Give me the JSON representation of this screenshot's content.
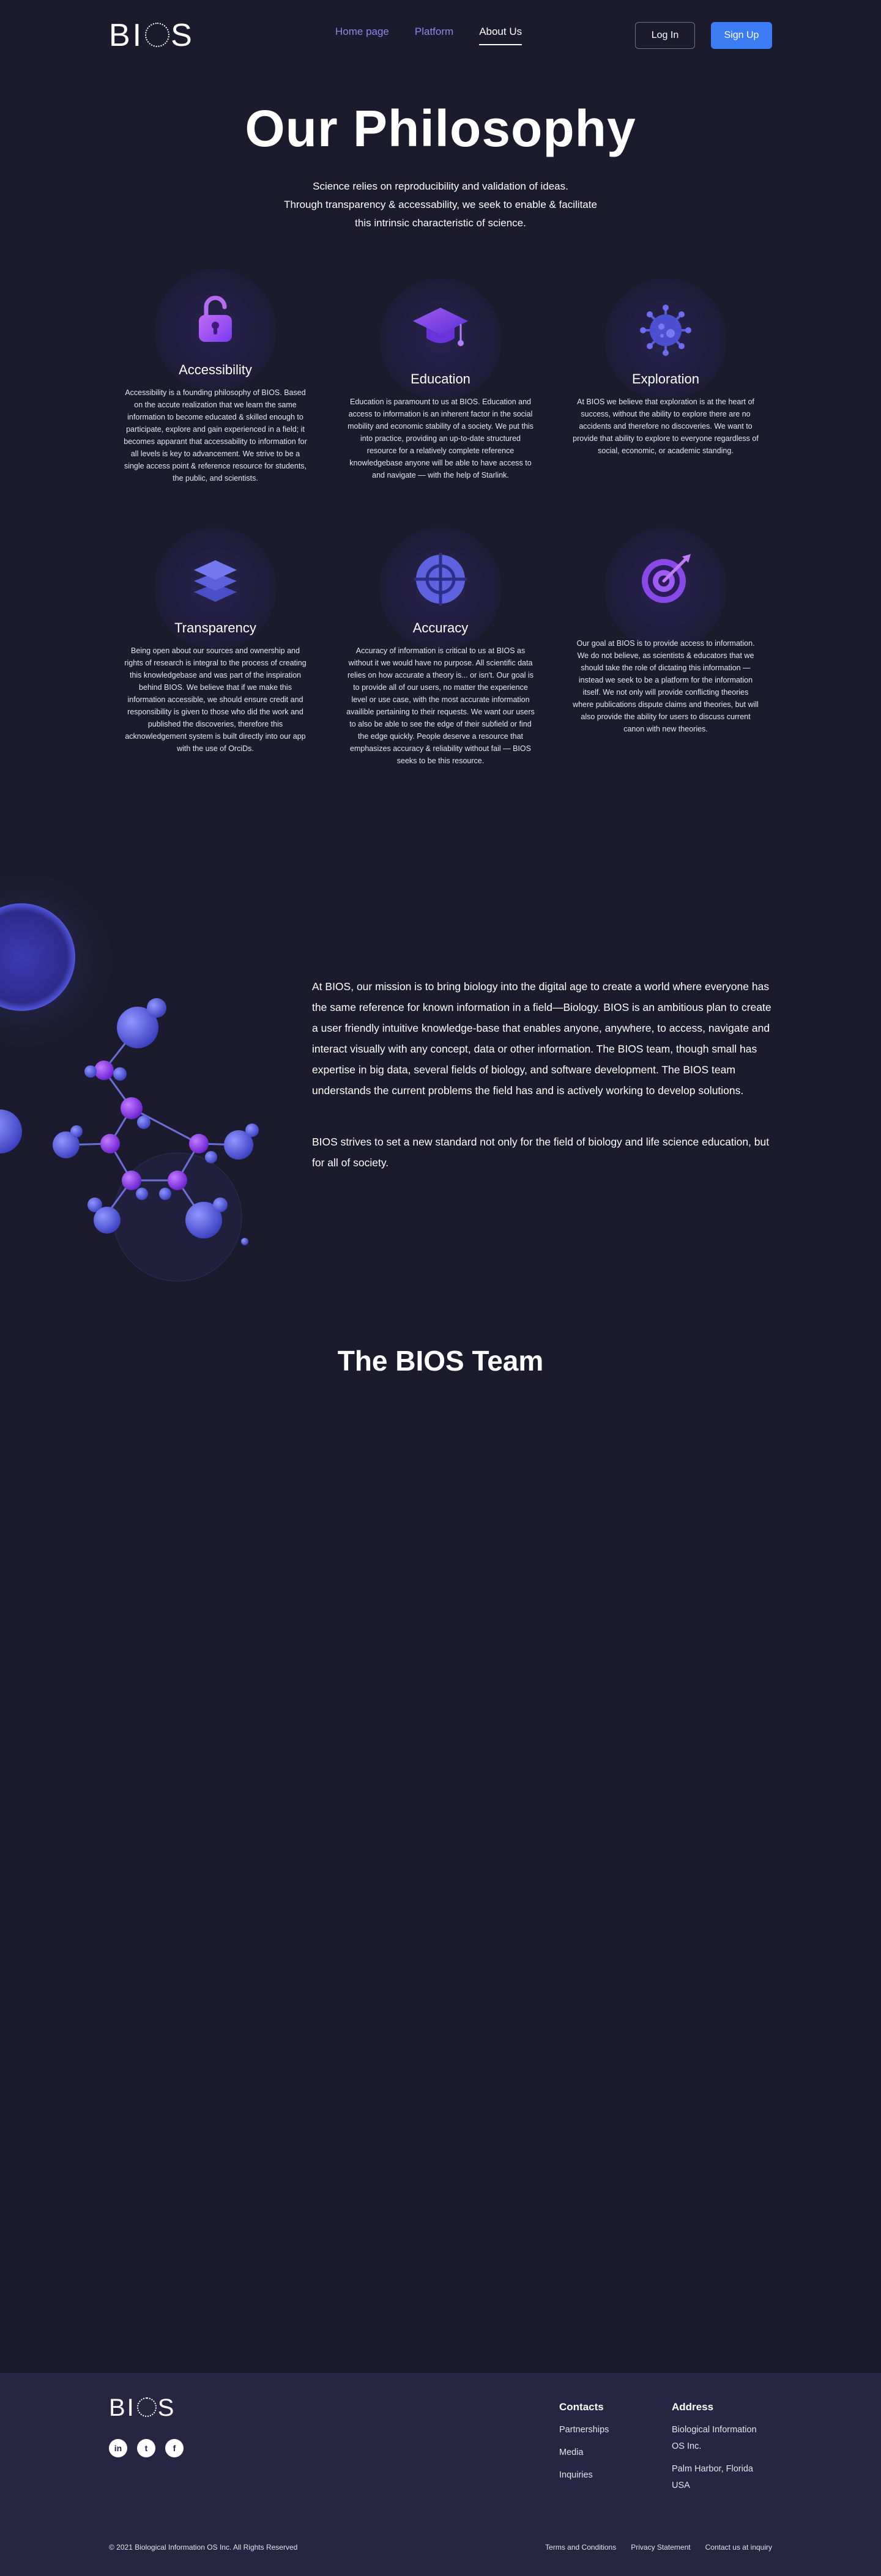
{
  "nav": {
    "logo": "BIOS",
    "links": [
      "Home page",
      "Platform",
      "About Us"
    ],
    "login": "Log In",
    "signup": "Sign Up"
  },
  "hero": {
    "title": "Our Philosophy",
    "subtitle_lines": [
      "Science relies on reproducibility and validation of ideas.",
      "Through transparency & accessability, we seek to enable & facilitate",
      "this intrinsic characteristic of science."
    ]
  },
  "pillars": [
    {
      "icon": "lock-icon",
      "title": "Accessibility",
      "text": "Accessibility is a founding philosophy of BIOS. Based on the accute realization that we learn the same information to become educated & skilled enough to participate, explore and gain experienced in a field; it becomes apparant that accessability to information for all levels is key to advancement. We strive to be a single access point & reference resource for students, the public, and scientists."
    },
    {
      "icon": "graduation-cap-icon",
      "title": "Education",
      "text": "Education is paramount to us at BIOS. Education and access to information is an inherent factor in the social mobility and economic stability of a society. We put this into practice, providing an up-to-date structured resource for a relatively complete reference knowledgebase anyone will be able to have access to and navigate — with the help of Starlink."
    },
    {
      "icon": "virus-icon",
      "title": "Exploration",
      "text": "At BIOS we believe that exploration is at the heart of success, without the ability to explore there are no accidents and therefore no discoveries. We want to provide that ability to explore to everyone regardless of social, economic, or academic standing."
    },
    {
      "icon": "layers-icon",
      "title": "Transparency",
      "text": "Being open about our sources and ownership and rights of research is integral to the process of creating this knowledgebase and was part of the inspiration behind BIOS. We believe that if we make this information accessible, we should ensure credit and responsibility is given to those who did the work and published the discoveries, therefore this acknowledgement system is built directly into our app with the use of OrciDs."
    },
    {
      "icon": "crosshair-icon",
      "title": "Accuracy",
      "text": "Accuracy of information is critical to us at BIOS as without it we would have no purpose. All scientific data relies on how accurate a theory is... or isn't. Our goal is to provide all of our users, no matter the experience level or use case, with the most accurate information availible pertaining to their requests. We want our users to also be able to see the edge of their subfield or find the edge quickly. People deserve a resource that emphasizes accuracy & reliability without fail — BIOS seeks to be this resource."
    },
    {
      "icon": "target-icon",
      "title": "",
      "text": "Our goal at BIOS is to provide access to information. We do not believe, as scientists & educators that we should take the role of dictating this information — instead we seek to be a platform for the information itself. We not only will provide conflicting theories where publications dispute claims and theories, but will also provide the ability for users to discuss current canon with new theories."
    }
  ],
  "mission": {
    "p1": "At BIOS, our mission is to bring biology into the digital age to create a world where everyone has the same reference for known information in a field—Biology. BIOS is an ambitious plan to create a user friendly intuitive knowledge-base that enables anyone,  anywhere, to access, navigate and interact visually with any concept, data or other information. The BIOS team, though small has expertise in big data, several fields of biology, and software development. The BIOS team understands the current problems the field has and is actively working to develop solutions.",
    "p2": "BIOS strives to set a new standard not only for the field of biology and life science education, but for all of society."
  },
  "team": {
    "title": "The BIOS Team"
  },
  "footer": {
    "logo": "BIOS",
    "socials": [
      "in",
      "t",
      "f"
    ],
    "contacts_title": "Contacts",
    "contacts": [
      "Partnerships",
      "Media",
      "Inquiries"
    ],
    "address_title": "Address",
    "address_company": [
      "Biological Information",
      "OS Inc."
    ],
    "address_city": [
      "Palm Harbor, Florida",
      "USA"
    ],
    "copyright": "© 2021 Biological Information OS Inc. All Rights Reserved",
    "links": [
      "Terms and Conditions",
      "Privacy Statement",
      "Contact us at inquiry"
    ]
  },
  "colors": {
    "background": "#1b1b2d",
    "accent_purple": "#8f86e6",
    "button_blue": "#3b7cf5",
    "footer_bg": "#262642"
  }
}
